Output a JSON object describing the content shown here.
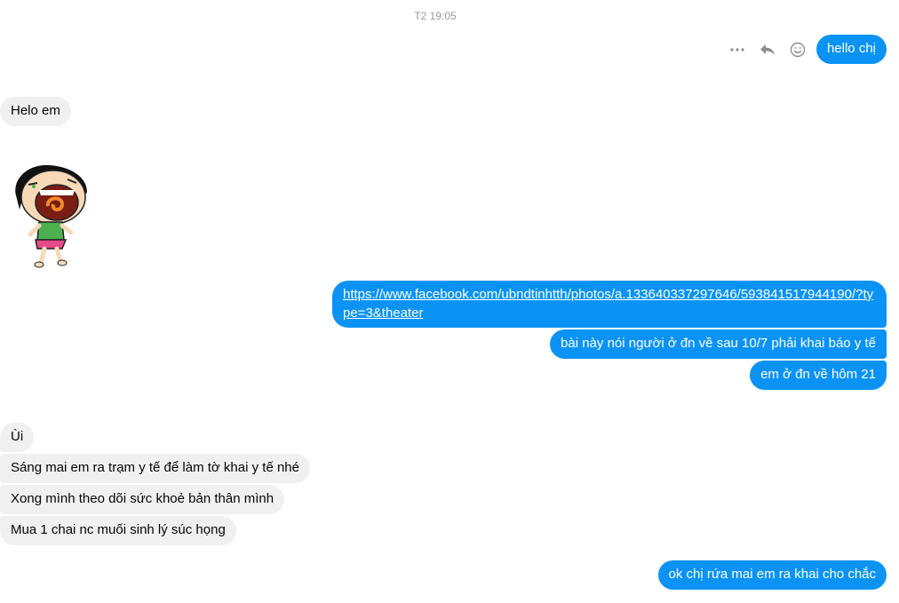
{
  "timestamp": "T2 19:05",
  "actions": {
    "more_icon": "more-icon",
    "reply_icon": "reply-icon",
    "react_icon": "emoji-icon"
  },
  "colors": {
    "outgoing": "#0a93f5",
    "incoming": "#f0f0f0"
  },
  "messages": {
    "m1": "hello chị",
    "m2": "Helo em",
    "m3_sticker": "cartoon-girl-laughing-sticker",
    "m4_link": "https://www.facebook.com/ubndtinhtth/photos/a.133640337297646/593841517944190/?type=3&theater",
    "m5": "bài này nói người ở đn về sau 10/7 phải khai báo y tế",
    "m6": "em ở đn về hôm 21",
    "m7": "Ùi",
    "m8": "Sáng mai em ra trạm y tế để  làm tờ khai y tế nhé",
    "m9": "Xong mình theo dõi sức khoẻ bản thân mình",
    "m10": "Mua 1 chai nc muối sinh lý súc họng",
    "m11": "ok chị rứa mai em ra khai cho chắc"
  }
}
